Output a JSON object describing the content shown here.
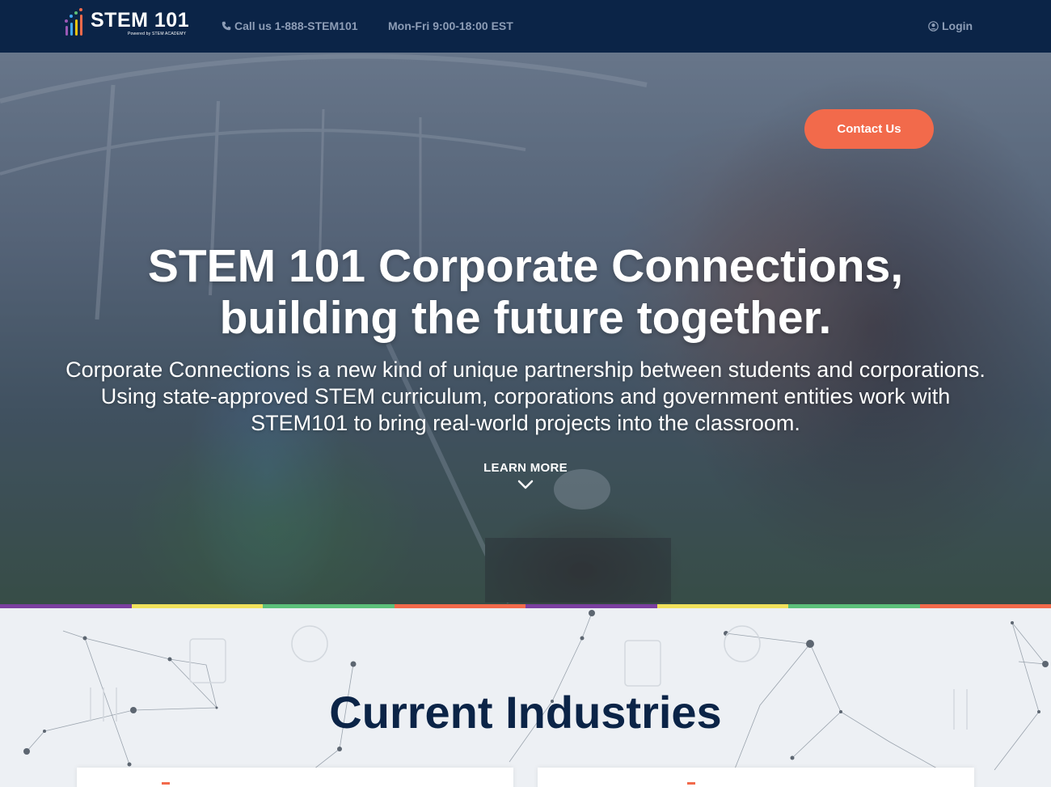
{
  "header": {
    "logo_text": "STEM 101",
    "logo_tagline": "Powered by STEM ACADEMY",
    "phone_text": "Call us 1-888-STEM101",
    "hours_text": "Mon-Fri 9:00-18:00 EST",
    "login_label": "Login",
    "icons": [
      "bar-chart-logo",
      "phone-icon",
      "user-circle-icon"
    ]
  },
  "hero": {
    "contact_label": "Contact Us",
    "title_line1": "STEM 101 Corporate Connections,",
    "title_line2": "building the future together.",
    "description": "Corporate Connections is a new kind of unique partnership between students and corporations. Using state-approved STEM curriculum, corporations and government entities work with STEM101 to bring real-world projects into the classroom.",
    "learn_more_label": "LEARN MORE",
    "icons": [
      "chevron-down-icon"
    ]
  },
  "stripe_colors": [
    "#7b3fa0",
    "#f1e15b",
    "#5cc07a",
    "#f26a4b",
    "#7b3fa0",
    "#f1e15b",
    "#5cc07a",
    "#f26a4b"
  ],
  "industries": {
    "title": "Current Industries"
  },
  "colors": {
    "navy": "#0b2447",
    "accent": "#f26a4b",
    "nav_text": "#8d9db6"
  }
}
